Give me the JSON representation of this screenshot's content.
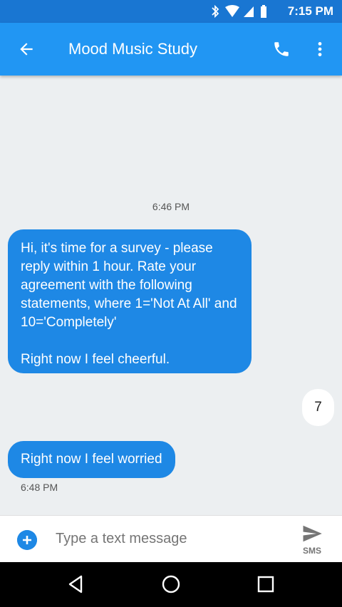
{
  "status_bar": {
    "time": "7:15 PM"
  },
  "app_bar": {
    "title": "Mood Music Study"
  },
  "conversation": {
    "date_stamp": "6:46 PM",
    "messages": [
      {
        "direction": "incoming",
        "lines": [
          "Hi, it's time for a survey - please reply within 1 hour. Rate your agreement with the following statements, where 1='Not At All' and 10='Completely'",
          "Right now I feel cheerful."
        ]
      },
      {
        "direction": "outgoing",
        "text": "7"
      },
      {
        "direction": "incoming",
        "text": "Right now I feel worried",
        "time": "6:48 PM"
      }
    ]
  },
  "compose": {
    "placeholder": "Type a text message",
    "send_label": "SMS"
  },
  "colors": {
    "status_bar": "#1976d2",
    "app_bar": "#2196f3",
    "incoming_bubble": "#1e88e5",
    "background": "#eceff1"
  }
}
